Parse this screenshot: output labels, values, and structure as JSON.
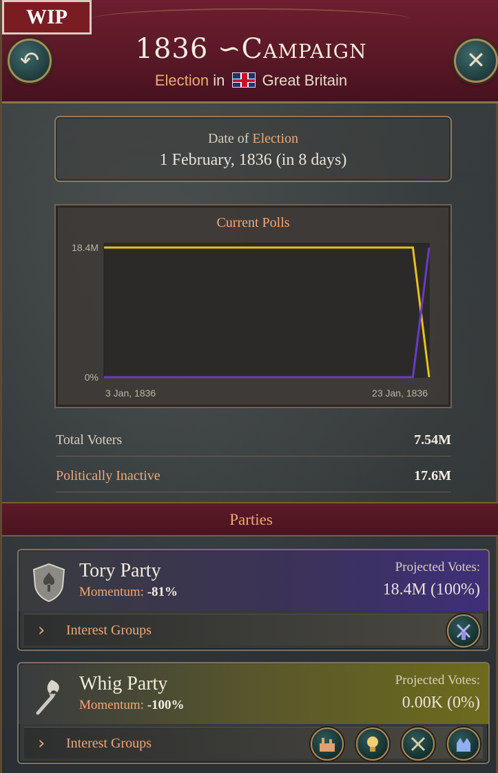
{
  "badge": "WIP",
  "header": {
    "title": "1836 ∽Campaign",
    "subtitle_prefix": "Election",
    "subtitle_in": "in",
    "subtitle_country": "Great Britain"
  },
  "date": {
    "label_prefix": "Date of",
    "label_accent": "Election",
    "value": "1 February, 1836 (in 8 days)"
  },
  "polls": {
    "title": "Current Polls"
  },
  "chart_data": {
    "type": "line",
    "title": "Current Polls",
    "x": [
      "3 Jan, 1836",
      "23 Jan, 1836"
    ],
    "x_tick_labels": [
      "3 Jan, 1836",
      "23 Jan, 1836"
    ],
    "y_tick_labels": [
      "18.4M",
      "0%"
    ],
    "ylim": [
      0,
      18.4
    ],
    "series": [
      {
        "color": "#e7c21e",
        "points": [
          [
            0,
            18.4
          ],
          [
            0.95,
            18.4
          ],
          [
            1.0,
            0
          ]
        ]
      },
      {
        "color": "#6a3bc4",
        "points": [
          [
            0,
            0
          ],
          [
            0.95,
            0
          ],
          [
            1.0,
            18.4
          ]
        ]
      }
    ]
  },
  "stats": {
    "total_voters_label": "Total Voters",
    "total_voters_value": "7.54M",
    "inactive_label": "Politically Inactive",
    "inactive_value": "17.6M"
  },
  "parties_header": "Parties",
  "parties": [
    {
      "name": "Tory Party",
      "momentum_label": "Momentum:",
      "momentum_value": "-81%",
      "projected_label": "Projected Votes:",
      "projected_value": "18.4M (100%)",
      "interest_groups_label": "Interest Groups",
      "icons": [
        "windmill-icon"
      ],
      "color": "#3e2f78"
    },
    {
      "name": "Whig Party",
      "momentum_label": "Momentum:",
      "momentum_value": "-100%",
      "projected_label": "Projected Votes:",
      "projected_value": "0.00K (0%)",
      "interest_groups_label": "Interest Groups",
      "icons": [
        "factory-icon",
        "lightbulb-icon",
        "crossed-swords-icon",
        "town-icon"
      ],
      "color": "#6d6b1c"
    }
  ]
}
